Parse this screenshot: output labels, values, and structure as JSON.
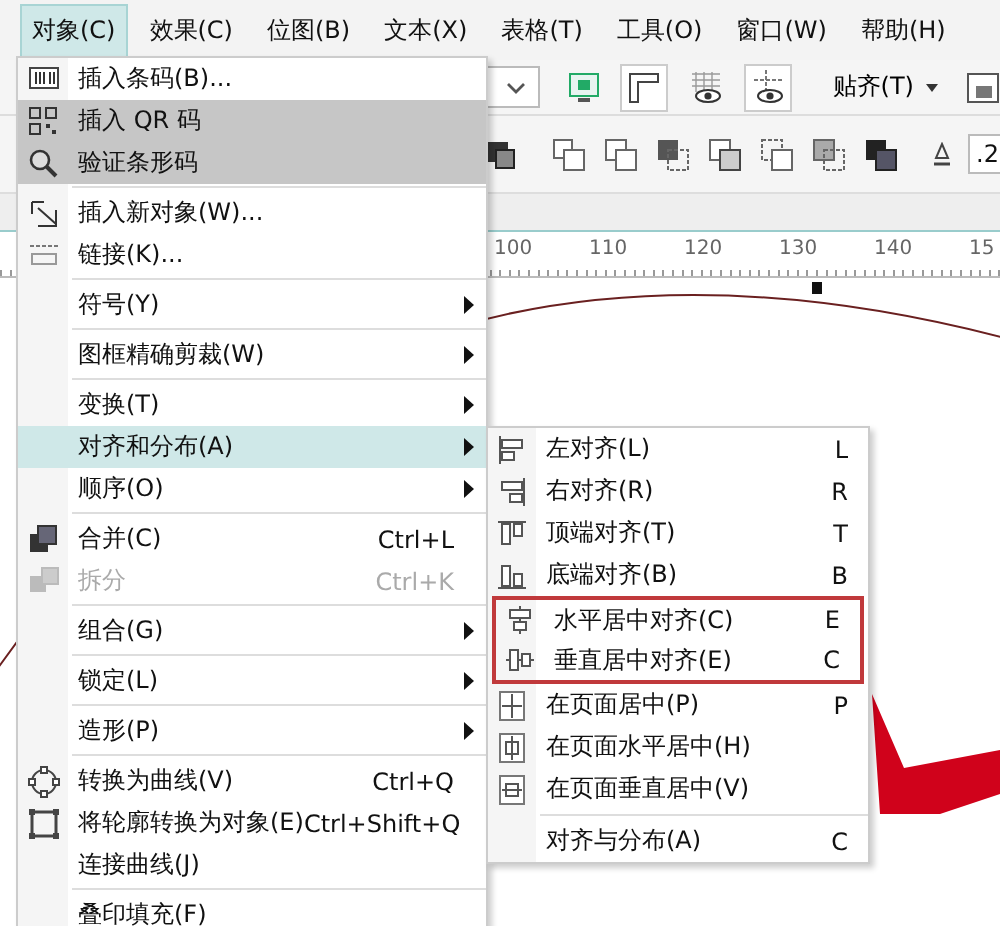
{
  "menu_bar": [
    {
      "label": "对象(C)",
      "selected": true
    },
    {
      "label": "效果(C)",
      "selected": false
    },
    {
      "label": "位图(B)",
      "selected": false
    },
    {
      "label": "文本(X)",
      "selected": false
    },
    {
      "label": "表格(T)",
      "selected": false
    },
    {
      "label": "工具(O)",
      "selected": false
    },
    {
      "label": "窗口(W)",
      "selected": false
    },
    {
      "label": "帮助(H)",
      "selected": false
    }
  ],
  "toolbar": {
    "snap_button": "贴齐(T)",
    "outline_width": ".2"
  },
  "ruler": {
    "labels": [
      "100",
      "110",
      "120",
      "130",
      "140",
      "15"
    ]
  },
  "object_menu": {
    "items": [
      {
        "kind": "item",
        "label": "插入条码(B)...",
        "selected": false,
        "shaded": false
      },
      {
        "kind": "item",
        "label": "插入 QR 码",
        "selected": false,
        "shaded": true
      },
      {
        "kind": "item",
        "label": "验证条形码",
        "selected": false,
        "shaded": true
      },
      {
        "kind": "separator"
      },
      {
        "kind": "item",
        "label": "插入新对象(W)...",
        "selected": false,
        "shaded": false
      },
      {
        "kind": "item",
        "label": "链接(K)...",
        "selected": false,
        "shaded": false
      },
      {
        "kind": "separator"
      },
      {
        "kind": "submenu",
        "label": "符号(Y)",
        "selected": false,
        "shaded": false
      },
      {
        "kind": "separator"
      },
      {
        "kind": "submenu",
        "label": "图框精确剪裁(W)",
        "selected": false,
        "shaded": false
      },
      {
        "kind": "separator"
      },
      {
        "kind": "submenu",
        "label": "变换(T)",
        "selected": false,
        "shaded": false
      },
      {
        "kind": "submenu",
        "label": "对齐和分布(A)",
        "selected": true,
        "shaded": false
      },
      {
        "kind": "submenu",
        "label": "顺序(O)",
        "selected": false,
        "shaded": false
      },
      {
        "kind": "separator"
      },
      {
        "kind": "item",
        "label": "合并(C)",
        "shortcut": "Ctrl+L",
        "selected": false,
        "shaded": false,
        "disabled": false
      },
      {
        "kind": "item",
        "label": "拆分",
        "shortcut": "Ctrl+K",
        "selected": false,
        "shaded": false,
        "disabled": true
      },
      {
        "kind": "separator"
      },
      {
        "kind": "submenu",
        "label": "组合(G)",
        "selected": false,
        "shaded": false
      },
      {
        "kind": "separator"
      },
      {
        "kind": "submenu",
        "label": "锁定(L)",
        "selected": false,
        "shaded": false
      },
      {
        "kind": "separator"
      },
      {
        "kind": "submenu",
        "label": "造形(P)",
        "selected": false,
        "shaded": false
      },
      {
        "kind": "separator"
      },
      {
        "kind": "item",
        "label": "转换为曲线(V)",
        "shortcut": "Ctrl+Q",
        "selected": false,
        "shaded": false
      },
      {
        "kind": "item",
        "label": "将轮廓转换为对象(E)",
        "shortcut": "Ctrl+Shift+Q",
        "selected": false,
        "shaded": false
      },
      {
        "kind": "item",
        "label": "连接曲线(J)",
        "selected": false,
        "shaded": false
      },
      {
        "kind": "separator"
      },
      {
        "kind": "item",
        "label": "叠印填充(F)",
        "selected": false,
        "shaded": false
      }
    ]
  },
  "align_submenu": {
    "items": [
      {
        "kind": "item",
        "label": "左对齐(L)",
        "shortcut": "L",
        "framed": false
      },
      {
        "kind": "item",
        "label": "右对齐(R)",
        "shortcut": "R",
        "framed": false
      },
      {
        "kind": "item",
        "label": "顶端对齐(T)",
        "shortcut": "T",
        "framed": false
      },
      {
        "kind": "item",
        "label": "底端对齐(B)",
        "shortcut": "B",
        "framed": false
      },
      {
        "kind": "item",
        "label": "水平居中对齐(C)",
        "shortcut": "E",
        "framed": true
      },
      {
        "kind": "item",
        "label": "垂直居中对齐(E)",
        "shortcut": "C",
        "framed": true
      },
      {
        "kind": "item",
        "label": "在页面居中(P)",
        "shortcut": "P",
        "framed": false
      },
      {
        "kind": "item",
        "label": "在页面水平居中(H)",
        "framed": false
      },
      {
        "kind": "item",
        "label": "在页面垂直居中(V)",
        "framed": false
      },
      {
        "kind": "separator"
      },
      {
        "kind": "item",
        "label": "对齐与分布(A)",
        "shortcut": "C",
        "framed": false
      }
    ]
  }
}
